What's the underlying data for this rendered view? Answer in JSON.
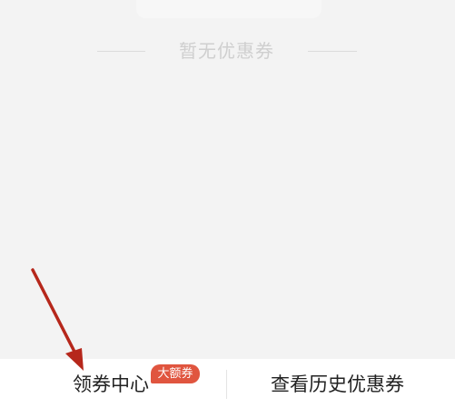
{
  "empty_state": {
    "message": "暂无优惠券"
  },
  "bottom_bar": {
    "coupon_center_label": "领券中心",
    "coupon_center_badge": "大额券",
    "history_label": "查看历史优惠券"
  },
  "colors": {
    "background": "#f3f3f3",
    "badge": "#e0553f",
    "arrow": "#b6271b",
    "text": "#222222",
    "muted_text": "#cfcfcf"
  },
  "icons": {
    "annotation": "arrow-icon"
  }
}
